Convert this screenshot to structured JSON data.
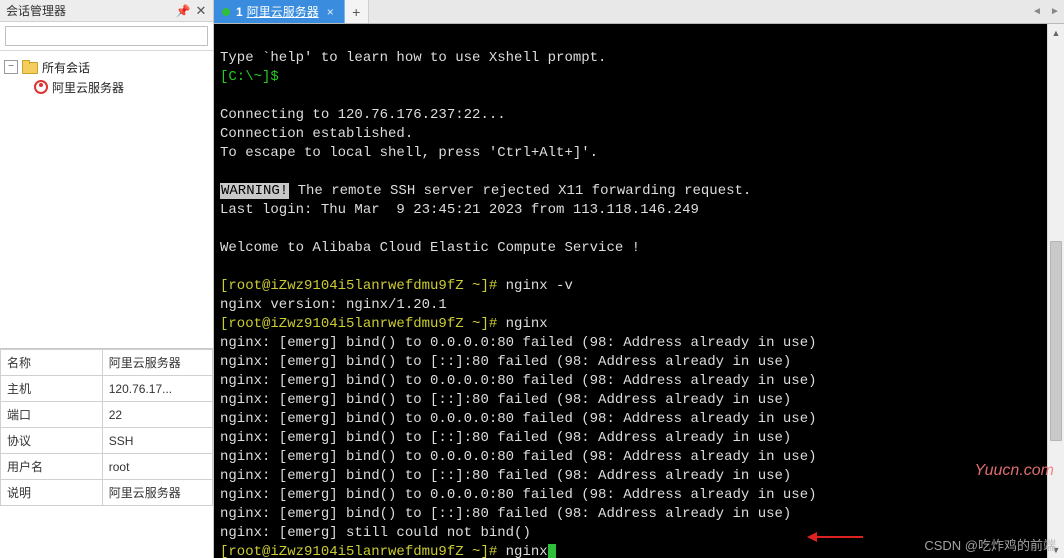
{
  "panel": {
    "title": "会话管理器",
    "search_placeholder": "",
    "tree": {
      "root_label": "所有会话",
      "session_label": "阿里云服务器"
    }
  },
  "props": {
    "rows": [
      {
        "key": "名称",
        "val": "阿里云服务器"
      },
      {
        "key": "主机",
        "val": "120.76.17..."
      },
      {
        "key": "端口",
        "val": "22"
      },
      {
        "key": "协议",
        "val": "SSH"
      },
      {
        "key": "用户名",
        "val": "root"
      },
      {
        "key": "说明",
        "val": "阿里云服务器"
      }
    ]
  },
  "tab": {
    "index": "1",
    "name": "阿里云服务器"
  },
  "terminal": {
    "l1": "Type `help' to learn how to use Xshell prompt.",
    "l2a": "[C:\\~]$",
    "blank": "",
    "l4": "Connecting to 120.76.176.237:22...",
    "l5": "Connection established.",
    "l6": "To escape to local shell, press 'Ctrl+Alt+]'.",
    "l8a": "WARNING!",
    "l8b": " The remote SSH server rejected X11 forwarding request.",
    "l9": "Last login: Thu Mar  9 23:45:21 2023 from 113.118.146.249",
    "l11": "Welcome to Alibaba Cloud Elastic Compute Service !",
    "p1a": "[root@iZwz9104i5lanrwefdmu9fZ ~]#",
    "p1b": " nginx -v",
    "l14": "nginx version: nginx/1.20.1",
    "p2b": " nginx",
    "e1": "nginx: [emerg] bind() to 0.0.0.0:80 failed (98: Address already in use)",
    "e2": "nginx: [emerg] bind() to [::]:80 failed (98: Address already in use)",
    "e3": "nginx: [emerg] bind() to 0.0.0.0:80 failed (98: Address already in use)",
    "e4": "nginx: [emerg] bind() to [::]:80 failed (98: Address already in use)",
    "e5": "nginx: [emerg] bind() to 0.0.0.0:80 failed (98: Address already in use)",
    "e6": "nginx: [emerg] bind() to [::]:80 failed (98: Address already in use)",
    "e7": "nginx: [emerg] bind() to 0.0.0.0:80 failed (98: Address already in use)",
    "e8": "nginx: [emerg] bind() to [::]:80 failed (98: Address already in use)",
    "e9": "nginx: [emerg] bind() to 0.0.0.0:80 failed (98: Address already in use)",
    "e10": "nginx: [emerg] bind() to [::]:80 failed (98: Address already in use)",
    "l26": "nginx: [emerg] still could not bind()",
    "p3b": " nginx"
  },
  "watermark1": "Yuucn.com",
  "watermark2": "CSDN @吃炸鸡的前端"
}
